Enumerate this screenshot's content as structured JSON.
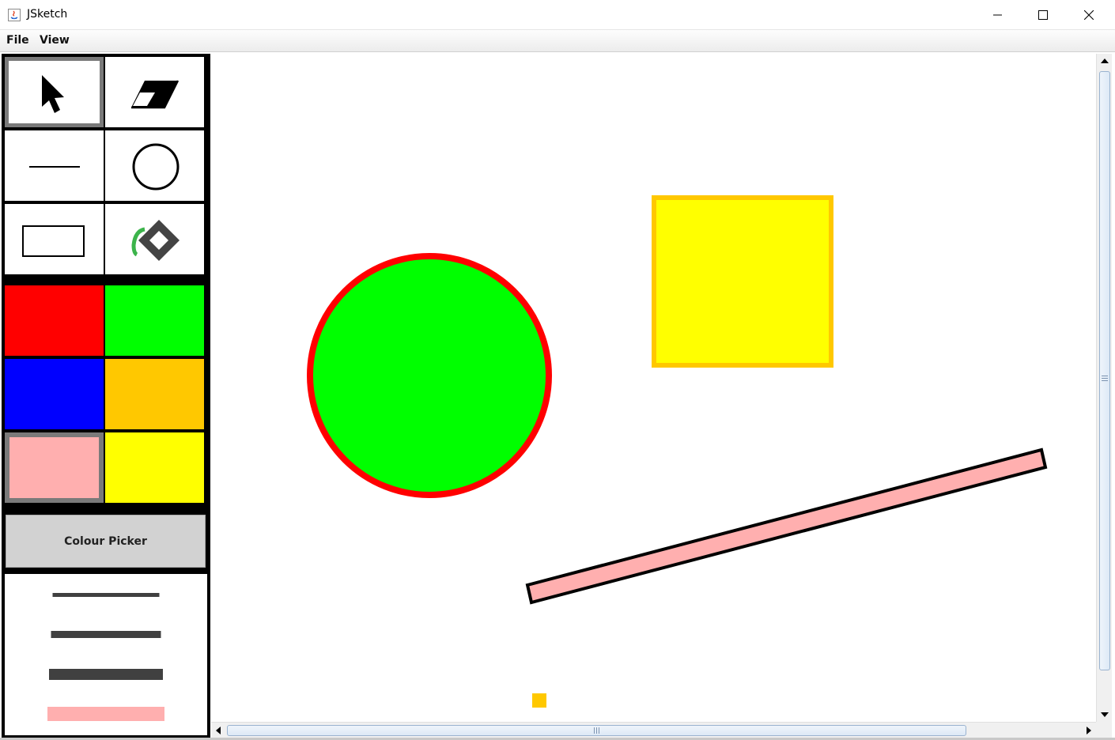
{
  "window": {
    "title": "JSketch",
    "minimize_icon": "minimize-icon",
    "maximize_icon": "maximize-icon",
    "close_icon": "close-icon"
  },
  "menu": [
    {
      "label": "File"
    },
    {
      "label": "View"
    }
  ],
  "tools": [
    {
      "name": "select",
      "icon": "cursor-icon",
      "selected": true
    },
    {
      "name": "erase",
      "icon": "eraser-icon",
      "selected": false
    },
    {
      "name": "line",
      "icon": "line-icon",
      "selected": false
    },
    {
      "name": "circle",
      "icon": "circle-icon",
      "selected": false
    },
    {
      "name": "rectangle",
      "icon": "rectangle-icon",
      "selected": false
    },
    {
      "name": "fill",
      "icon": "paint-bucket-icon",
      "selected": false
    }
  ],
  "palette": [
    {
      "color": "#ff0000",
      "selected": false
    },
    {
      "color": "#00ff00",
      "selected": false
    },
    {
      "color": "#0000ff",
      "selected": false
    },
    {
      "color": "#ffc800",
      "selected": false
    },
    {
      "color": "#ffafaf",
      "selected": true
    },
    {
      "color": "#ffff00",
      "selected": false
    }
  ],
  "colour_picker": {
    "label": "Colour Picker"
  },
  "thickness_options": [
    {
      "level": 1,
      "color": "#404040",
      "selected": false
    },
    {
      "level": 2,
      "color": "#404040",
      "selected": false
    },
    {
      "level": 3,
      "color": "#404040",
      "selected": false
    },
    {
      "level": 4,
      "color": "#ffafaf",
      "selected": true
    }
  ],
  "shapes": [
    {
      "type": "circle",
      "fill": "#00ff00",
      "stroke": "#ff0000"
    },
    {
      "type": "rectangle",
      "fill": "#ffff00",
      "stroke": "#ffc800"
    },
    {
      "type": "line",
      "fill": "#ffafaf",
      "stroke": "#000000"
    },
    {
      "type": "rectangle",
      "fill": "#ffc800",
      "stroke": "#ffc800"
    }
  ]
}
